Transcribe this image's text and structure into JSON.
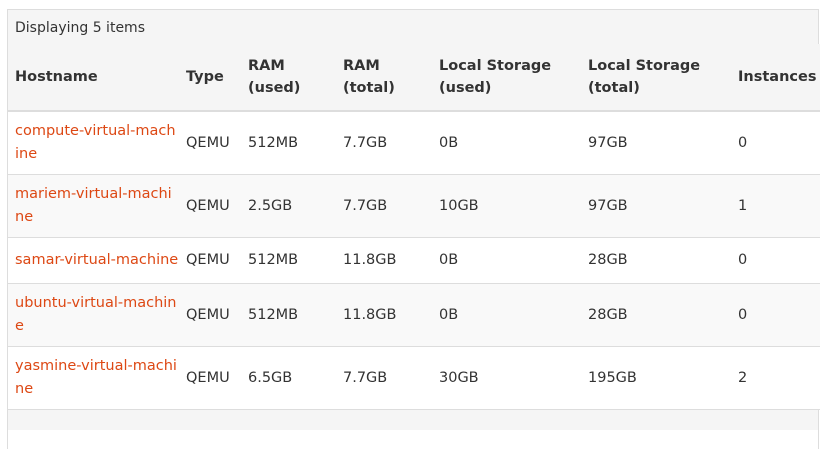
{
  "caption": "Displaying 5 items",
  "columns": [
    {
      "line1": "Hostname",
      "line2": ""
    },
    {
      "line1": "Type",
      "line2": ""
    },
    {
      "line1": "RAM",
      "line2": "(used)"
    },
    {
      "line1": "RAM",
      "line2": "(total)"
    },
    {
      "line1": "Local Storage",
      "line2": "(used)"
    },
    {
      "line1": "Local Storage",
      "line2": "(total)"
    },
    {
      "line1": "Instances",
      "line2": ""
    }
  ],
  "rows": [
    {
      "hostname": "compute-virtual-machine",
      "type": "QEMU",
      "ram_used": "512MB",
      "ram_total": "7.7GB",
      "storage_used": "0B",
      "storage_total": "97GB",
      "instances": "0"
    },
    {
      "hostname": "mariem-virtual-machine",
      "type": "QEMU",
      "ram_used": "2.5GB",
      "ram_total": "7.7GB",
      "storage_used": "10GB",
      "storage_total": "97GB",
      "instances": "1"
    },
    {
      "hostname": "samar-virtual-machine",
      "type": "QEMU",
      "ram_used": "512MB",
      "ram_total": "11.8GB",
      "storage_used": "0B",
      "storage_total": "28GB",
      "instances": "0"
    },
    {
      "hostname": "ubuntu-virtual-machine",
      "type": "QEMU",
      "ram_used": "512MB",
      "ram_total": "11.8GB",
      "storage_used": "0B",
      "storage_total": "28GB",
      "instances": "0"
    },
    {
      "hostname": "yasmine-virtual-machine",
      "type": "QEMU",
      "ram_used": "6.5GB",
      "ram_total": "7.7GB",
      "storage_used": "30GB",
      "storage_total": "195GB",
      "instances": "2"
    }
  ],
  "colors": {
    "link": "#dd4814",
    "header_bg": "#f5f5f5",
    "border": "#dddddd"
  }
}
